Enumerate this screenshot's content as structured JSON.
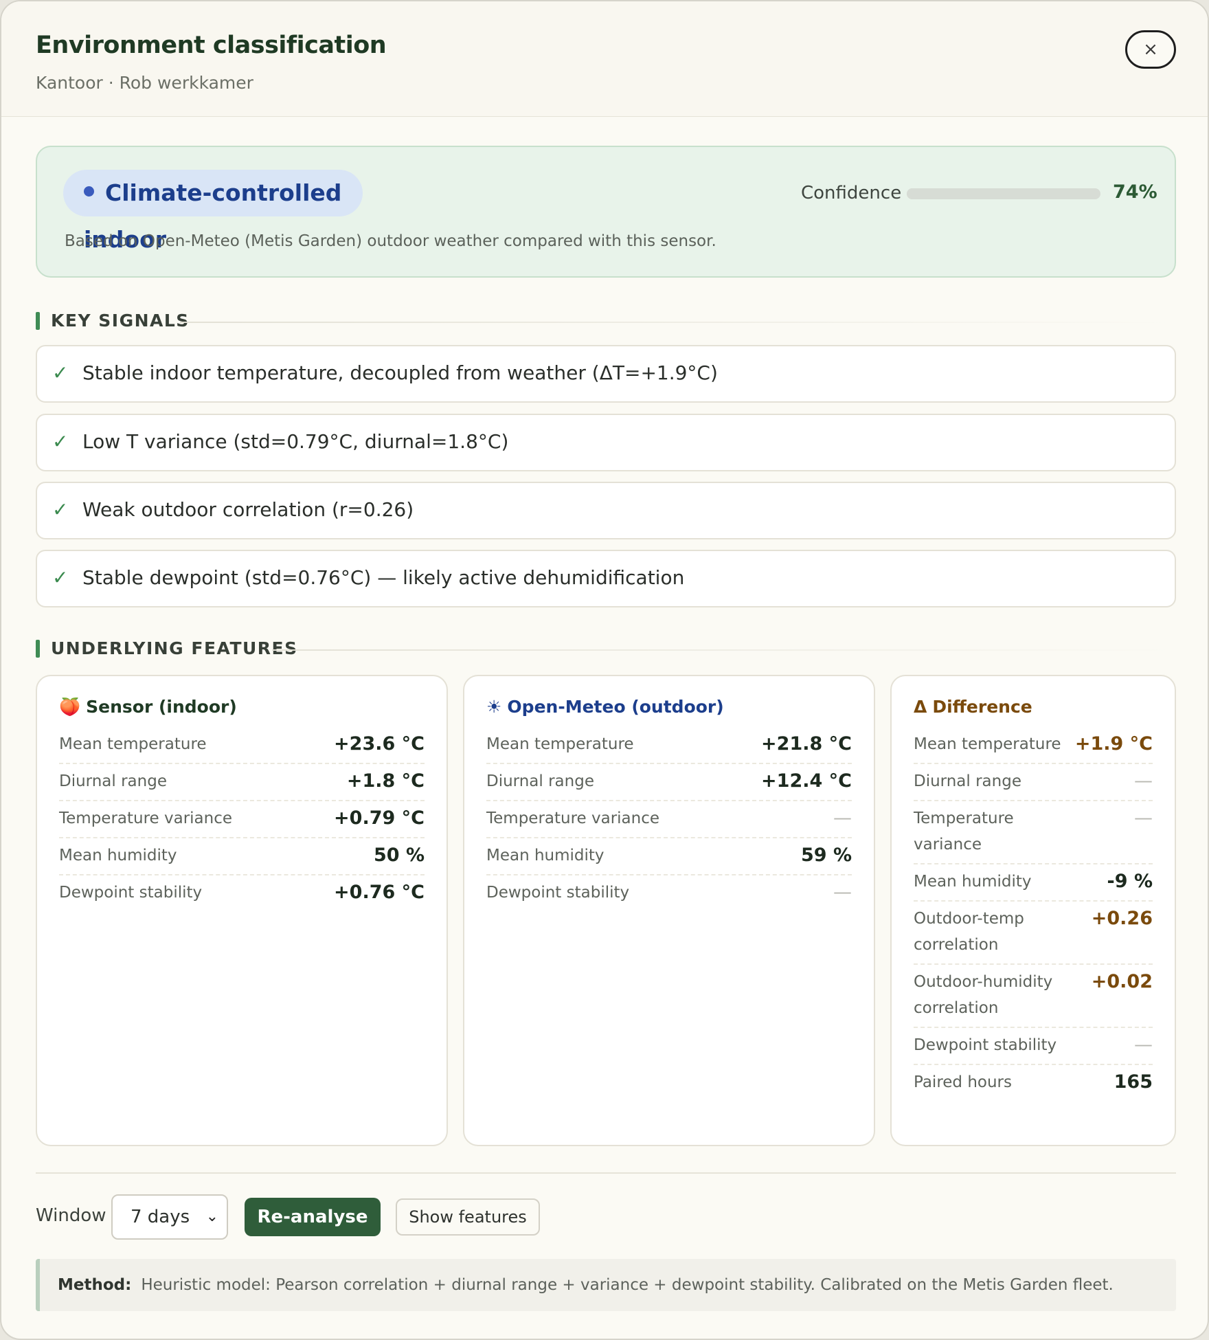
{
  "header": {
    "title": "Environment classification",
    "subtitle": "Kantoor · Rob werkkamer",
    "close_label": "×"
  },
  "summary": {
    "classification": "Climate-controlled indoor",
    "confidence_label": "Confidence",
    "confidence_value": "74%",
    "confidence_fraction": 0.74,
    "note": "Based on Open-Meteo (Metis Garden) outdoor weather compared with this sensor."
  },
  "key_signals": {
    "heading": "KEY SIGNALS",
    "check_icon": "✓",
    "items": [
      "Stable indoor temperature, decoupled from weather (ΔT=+1.9°C)",
      "Low T variance (std=0.79°C, diurnal=1.8°C)",
      "Weak outdoor correlation (r=0.26)",
      "Stable dewpoint (std=0.76°C) — likely active dehumidification"
    ]
  },
  "features": {
    "heading": "UNDERLYING FEATURES",
    "sensor": {
      "icon": "🍑",
      "title": "Sensor (indoor)",
      "rows": [
        {
          "label": "Mean temperature",
          "value": "+23.6 °C"
        },
        {
          "label": "Diurnal range",
          "value": "+1.8 °C"
        },
        {
          "label": "Temperature variance",
          "value": "+0.79 °C"
        },
        {
          "label": "Mean humidity",
          "value": "50 %"
        },
        {
          "label": "Dewpoint stability",
          "value": "+0.76 °C"
        }
      ]
    },
    "outdoor": {
      "icon": "☀",
      "title": "Open-Meteo (outdoor)",
      "rows": [
        {
          "label": "Mean temperature",
          "value": "+21.8 °C"
        },
        {
          "label": "Diurnal range",
          "value": "+12.4 °C"
        },
        {
          "label": "Temperature variance",
          "value": "—"
        },
        {
          "label": "Mean humidity",
          "value": "59 %"
        },
        {
          "label": "Dewpoint stability",
          "value": "—"
        }
      ]
    },
    "difference": {
      "icon": "Δ",
      "title": "Difference",
      "rows": [
        {
          "label": "Mean temperature",
          "value": "+1.9 °C"
        },
        {
          "label": "Diurnal range",
          "value": "—"
        },
        {
          "label": "Temperature variance",
          "value": "—"
        },
        {
          "label": "Mean humidity",
          "value": "-9 %"
        },
        {
          "label": "Outdoor-temp correlation",
          "value": "+0.26"
        },
        {
          "label": "Outdoor-humidity correlation",
          "value": "+0.02"
        },
        {
          "label": "Dewpoint stability",
          "value": "—"
        },
        {
          "label": "Paired hours",
          "value": "165"
        }
      ]
    }
  },
  "controls": {
    "window_label": "Window",
    "window_value": "7 days",
    "reanalyse_label": "Re-analyse",
    "show_features_label": "Show features"
  },
  "method": {
    "label": "Method:",
    "text": "Heuristic model: Pearson correlation + diurnal range + variance + dewpoint stability. Calibrated on the Metis Garden fleet."
  },
  "colors": {
    "accent_green": "#2f5d3a",
    "classification_blue": "#1c3e8c",
    "difference_brown": "#7a4a0c"
  }
}
